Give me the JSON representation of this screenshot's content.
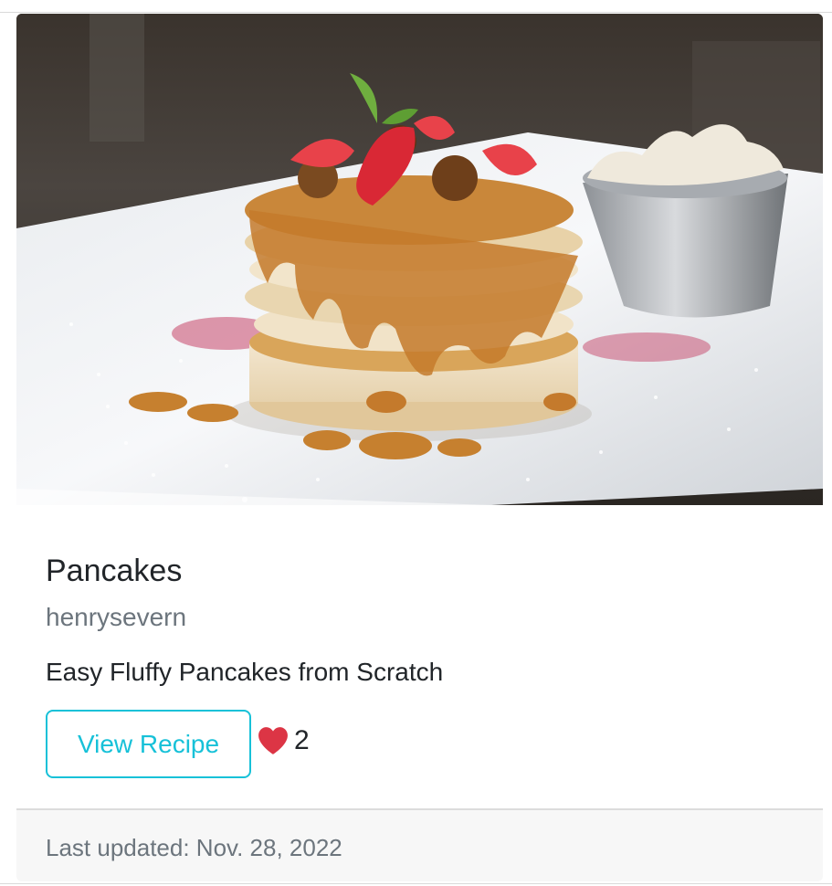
{
  "card": {
    "image_alt": "Pancakes",
    "title": "Pancakes",
    "author": "henrysevern",
    "description": "Easy Fluffy Pancakes from Scratch",
    "view_button_label": "View Recipe",
    "like_icon": "heart-icon",
    "like_count": "2",
    "footer_text": "Last updated: Nov. 28, 2022"
  },
  "colors": {
    "accent": "#17c1d8",
    "heart": "#dc3545",
    "muted_text": "#6c757d",
    "text": "#212529",
    "footer_bg": "#f7f7f7"
  }
}
